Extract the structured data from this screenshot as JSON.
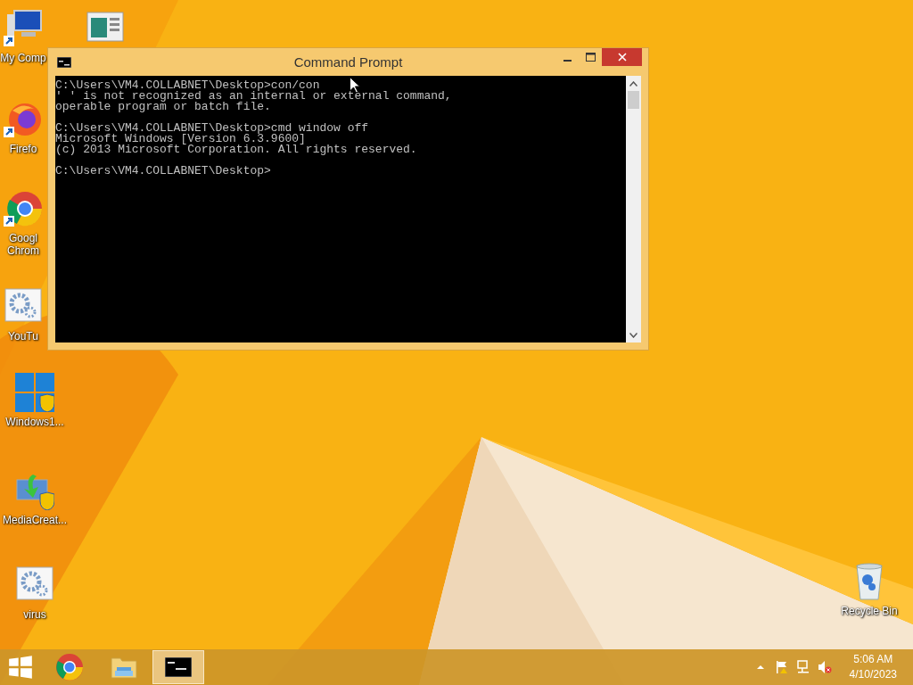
{
  "desktop_icons": [
    {
      "label": "My Comp",
      "selected": false
    },
    {
      "selected": false
    },
    {
      "label": "Firefo",
      "selected": false
    },
    {
      "label": "Googl Chrom",
      "selected": false
    },
    {
      "label": "YouTu",
      "selected": false
    },
    {
      "label": "Windows1...",
      "selected": false
    },
    {
      "label": "MediaCreat...",
      "selected": false
    },
    {
      "label": "virus",
      "selected": false
    },
    {
      "label": "Recycle Bin",
      "selected": false
    }
  ],
  "window": {
    "title": "Command Prompt",
    "console_blocks": [
      [
        "C:\\Users\\VM4.COLLABNET\\Desktop>con/con",
        "' ' is not recognized as an internal or external command,",
        "operable program or batch file."
      ],
      [
        "C:\\Users\\VM4.COLLABNET\\Desktop>cmd window off",
        "Microsoft Windows [Version 6.3.9600]",
        "(c) 2013 Microsoft Corporation. All rights reserved."
      ],
      [
        "C:\\Users\\VM4.COLLABNET\\Desktop>"
      ]
    ]
  },
  "taskbar": {
    "items": [
      {
        "selected": false
      },
      {
        "selected": false
      },
      {
        "selected": true
      }
    ],
    "clock": {
      "time": "5:06 AM",
      "date": "4/10/2023"
    }
  }
}
